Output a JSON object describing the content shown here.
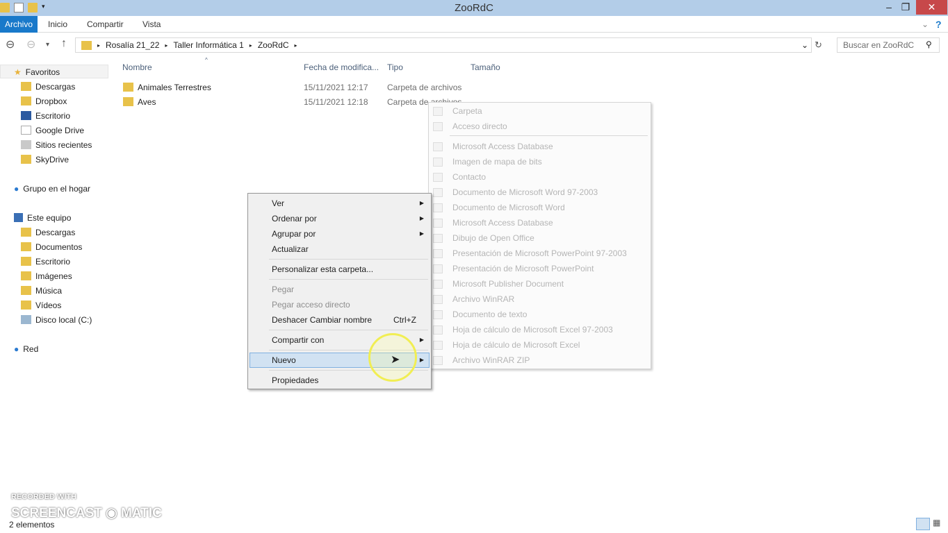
{
  "window": {
    "title": "ZooRdC"
  },
  "ribbon": {
    "tabs": [
      "Archivo",
      "Inicio",
      "Compartir",
      "Vista"
    ]
  },
  "address": {
    "crumbs": [
      "Rosalía 21_22",
      "Taller Informática 1",
      "ZooRdC"
    ]
  },
  "search": {
    "placeholder": "Buscar en ZooRdC"
  },
  "sidebar": {
    "favorites": {
      "label": "Favoritos",
      "items": [
        "Descargas",
        "Dropbox",
        "Escritorio",
        "Google Drive",
        "Sitios recientes",
        "SkyDrive"
      ]
    },
    "homegroup": "Grupo en el hogar",
    "pc": {
      "label": "Este equipo",
      "items": [
        "Descargas",
        "Documentos",
        "Escritorio",
        "Imágenes",
        "Música",
        "Vídeos",
        "Disco local (C:)"
      ]
    },
    "network": "Red"
  },
  "columns": [
    "Nombre",
    "Fecha de modifica...",
    "Tipo",
    "Tamaño"
  ],
  "files": [
    {
      "name": "Animales Terrestres",
      "date": "15/11/2021 12:17",
      "type": "Carpeta de archivos"
    },
    {
      "name": "Aves",
      "date": "15/11/2021 12:18",
      "type": "Carpeta de archivos"
    }
  ],
  "context_menu": {
    "ver": "Ver",
    "ordenar": "Ordenar por",
    "agrupar": "Agrupar por",
    "actualizar": "Actualizar",
    "personalizar": "Personalizar esta carpeta...",
    "pegar": "Pegar",
    "pegar_acceso": "Pegar acceso directo",
    "deshacer": "Deshacer Cambiar nombre",
    "deshacer_shortcut": "Ctrl+Z",
    "compartir": "Compartir con",
    "nuevo": "Nuevo",
    "propiedades": "Propiedades"
  },
  "new_submenu": [
    "Carpeta",
    "Acceso directo",
    "Microsoft Access Database",
    "Imagen de mapa de bits",
    "Contacto",
    "Documento de Microsoft Word 97-2003",
    "Documento de Microsoft Word",
    "Microsoft Access Database",
    "Dibujo de Open Office",
    "Presentación de Microsoft PowerPoint 97-2003",
    "Presentación de Microsoft PowerPoint",
    "Microsoft Publisher Document",
    "Archivo WinRAR",
    "Documento de texto",
    "Hoja de cálculo de Microsoft Excel 97-2003",
    "Hoja de cálculo de Microsoft Excel",
    "Archivo WinRAR ZIP"
  ],
  "status": {
    "count": "2 elementos"
  },
  "watermark": {
    "line1": "RECORDED WITH",
    "line2": "SCREENCAST-O-MATIC"
  },
  "colors": {
    "accent": "#1979ca",
    "titlebar": "#b3cde8",
    "close": "#c7484a"
  }
}
